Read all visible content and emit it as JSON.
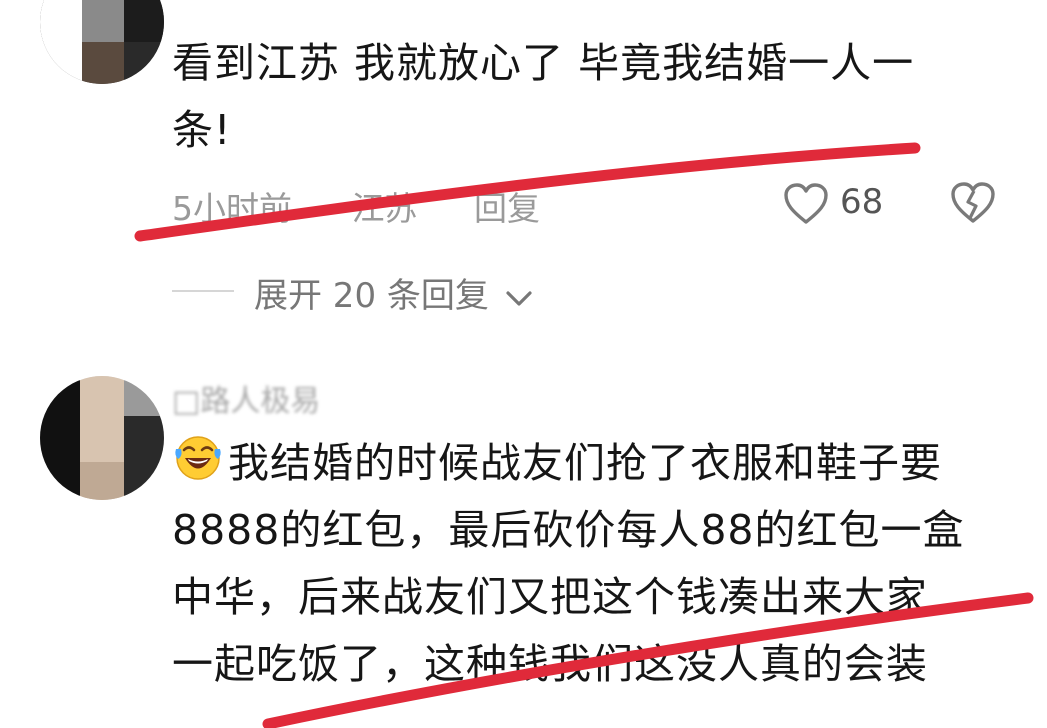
{
  "comment_1": {
    "text_line_1": "看到江苏 我就放心了 毕竟我结婚一人一",
    "text_line_2": "条!",
    "time": "5小时前",
    "separator": "·",
    "location": "江苏",
    "reply_label": "回复",
    "like_count": "68",
    "like_icon": "heart-outline-icon",
    "dislike_icon": "broken-heart-icon",
    "expand_label": "展开 20 条回复",
    "expand_icon": "chevron-down-icon"
  },
  "comment_2": {
    "username": "□路人极易",
    "emoji": "laughing-tears-emoji",
    "text_line_1": "我结婚的时候战友们抢了衣服和鞋子要",
    "text_line_2": "8888的红包，最后砍价每人88的红包一盒",
    "text_line_3": "中华，后来战友们又把这个钱凑出来大家",
    "text_line_4": "一起吃饭了，这种钱我们这没人真的会装"
  },
  "colors": {
    "annotation_red": "#e02a3a",
    "text": "#161616",
    "meta": "#9a9a9a"
  }
}
